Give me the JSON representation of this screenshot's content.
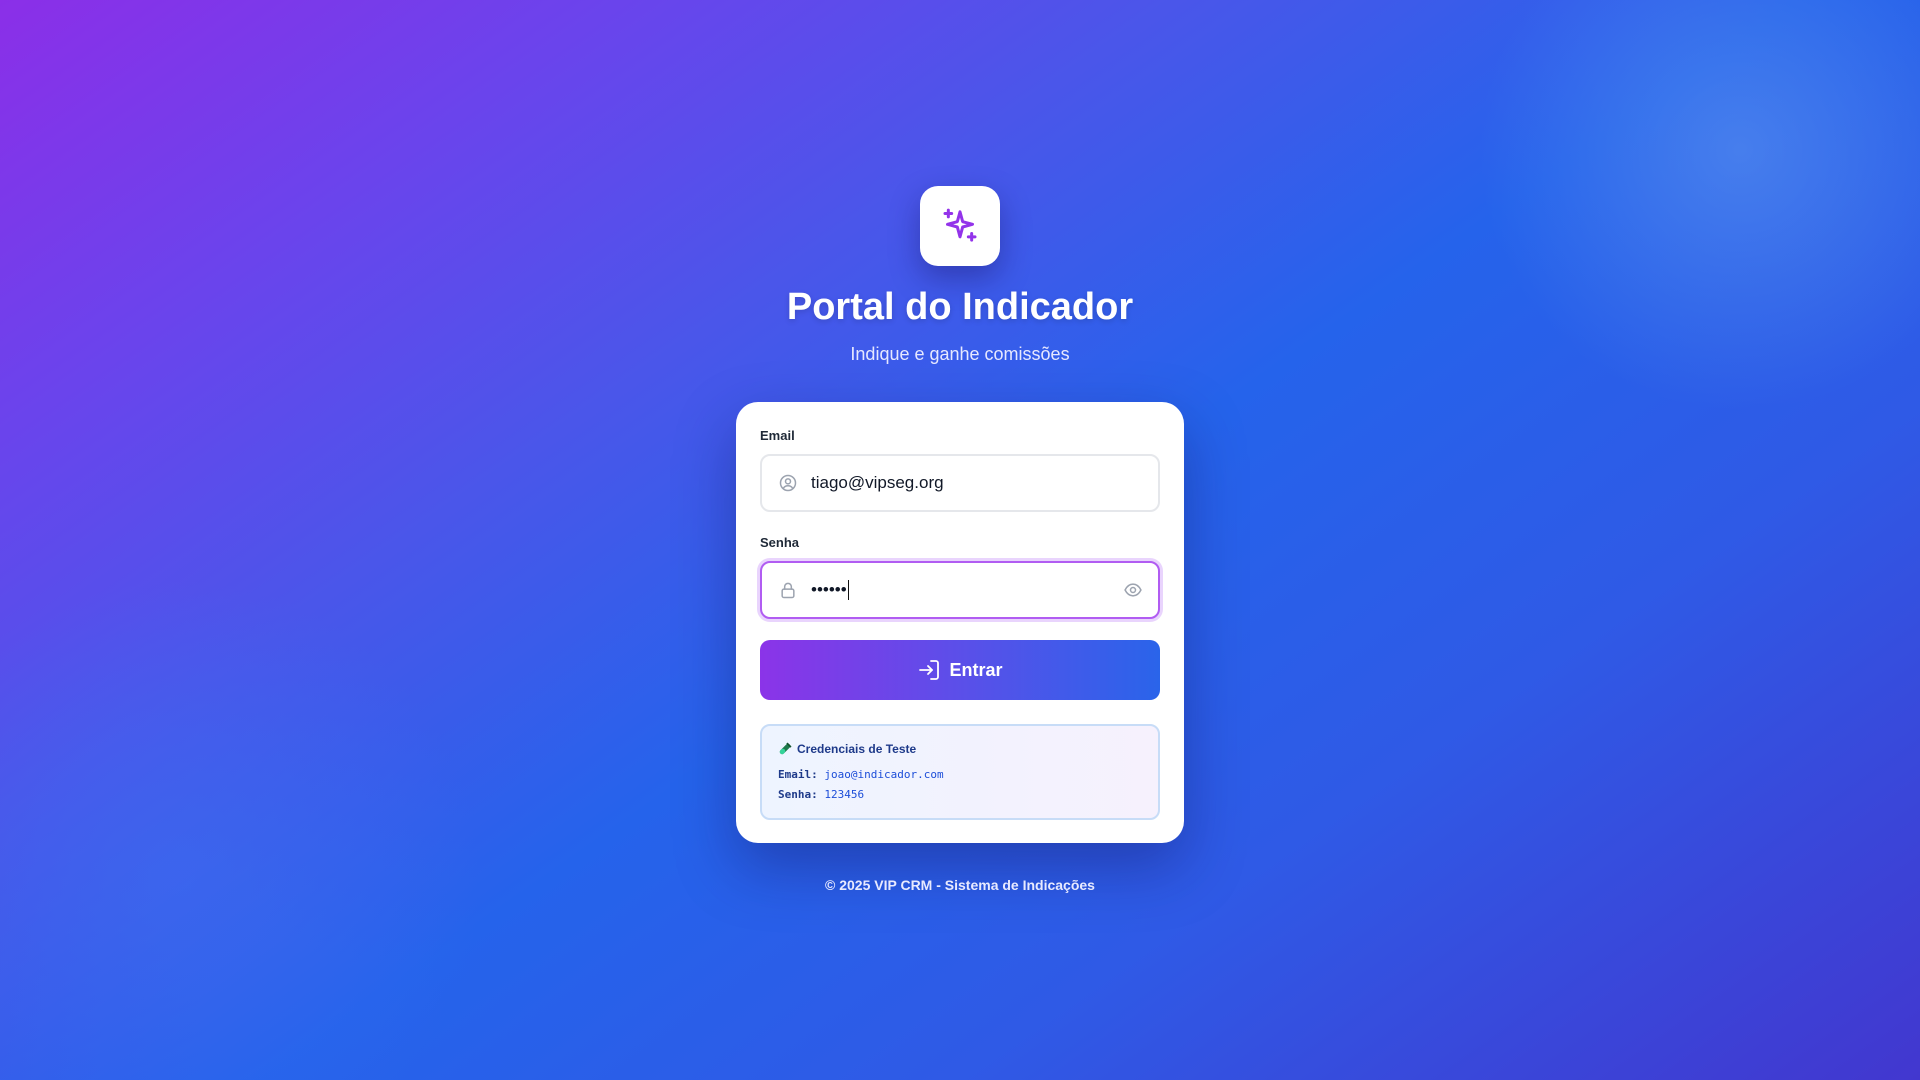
{
  "header": {
    "title": "Portal do Indicador",
    "subtitle": "Indique e ganhe comissões"
  },
  "form": {
    "email_label": "Email",
    "email_value": "tiago@vipseg.org",
    "password_label": "Senha",
    "password_value": "••••••",
    "submit_label": "Entrar"
  },
  "test_credentials": {
    "title": "Credenciais de Teste",
    "email_key": "Email:",
    "email_value": "joao@indicador.com",
    "password_key": "Senha:",
    "password_value": "123456"
  },
  "footer": {
    "text": "© 2025 VIP CRM - Sistema de Indicações"
  },
  "icons": {
    "logo": "sparkles-icon",
    "email_field": "user-circle-icon",
    "password_field": "lock-icon",
    "password_toggle": "eye-icon",
    "submit": "login-icon",
    "credentials": "test-tube-icon"
  },
  "colors": {
    "accent_purple": "#8b34e8",
    "accent_blue": "#2a64ea",
    "focus_border": "#b15cf2"
  }
}
